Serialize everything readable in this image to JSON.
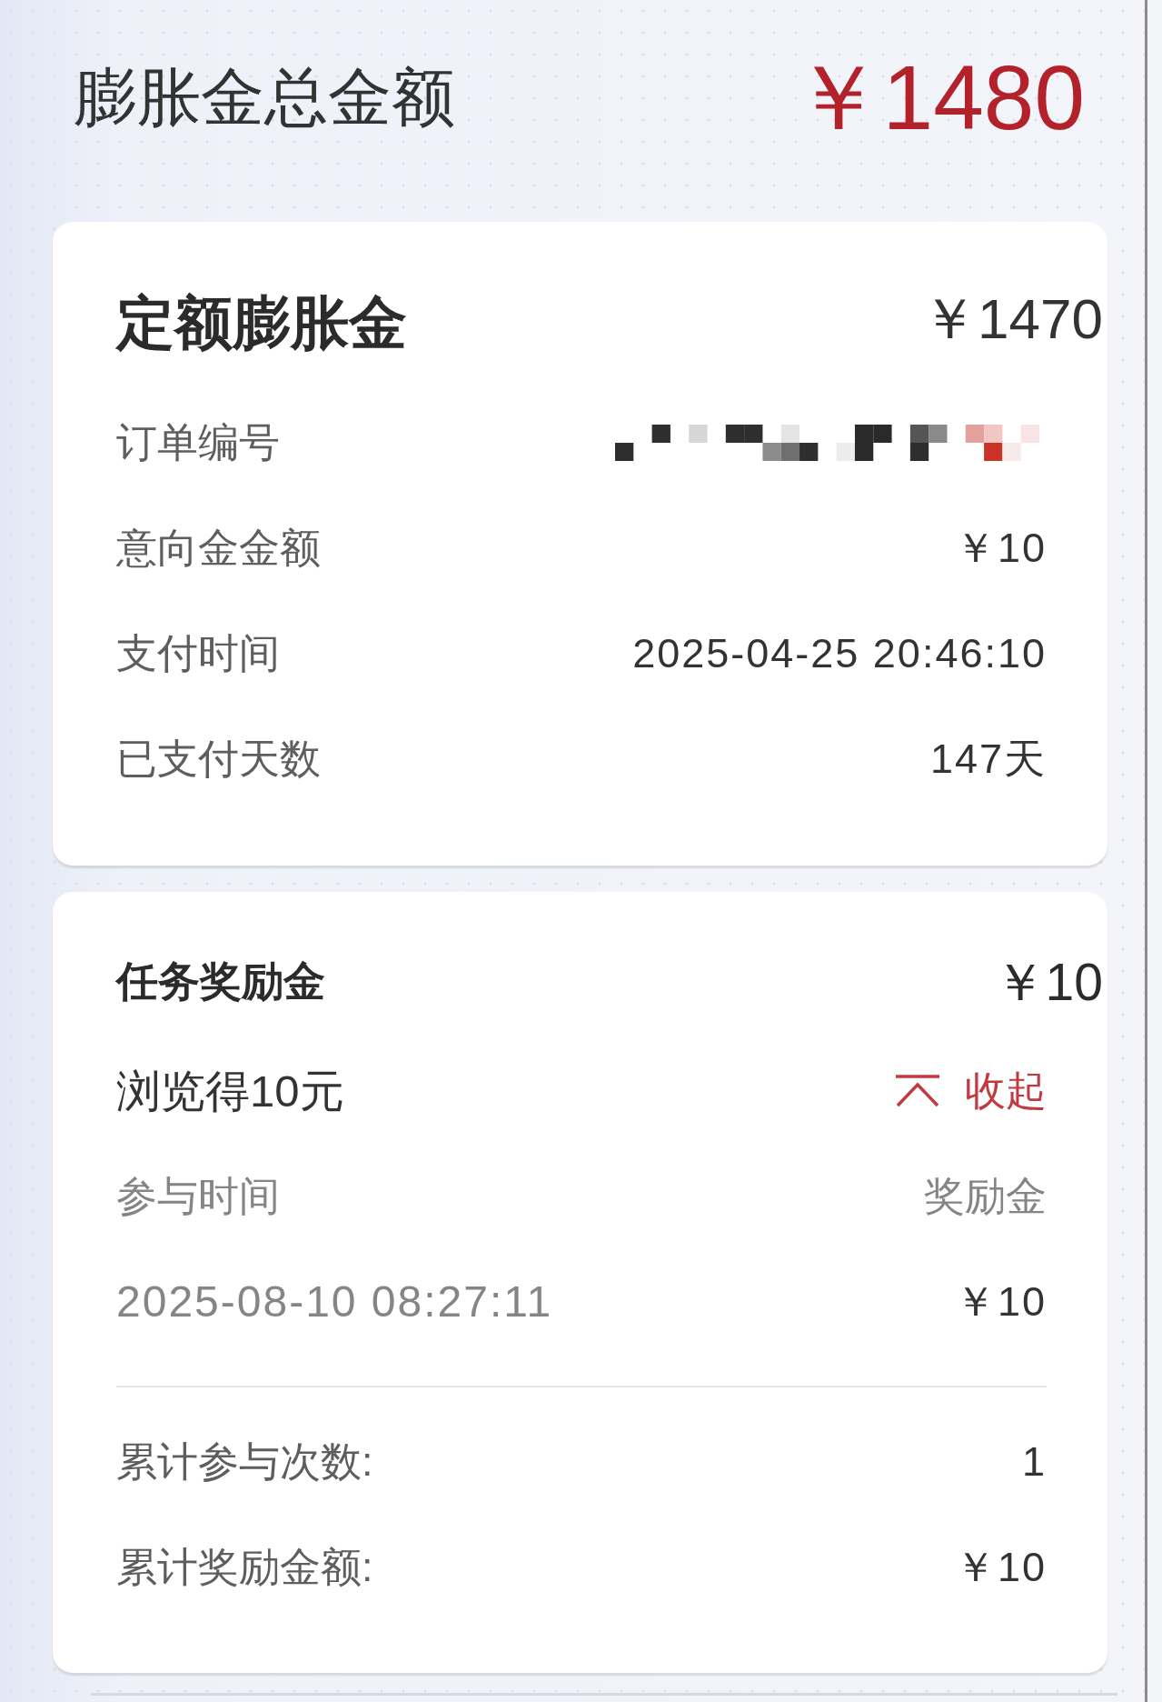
{
  "header": {
    "title": "膨胀金总金额",
    "amount": "￥1480"
  },
  "fixed_bonus": {
    "title": "定额膨胀金",
    "amount": "￥1470",
    "rows": [
      {
        "kind": "redacted",
        "label": "订单编号"
      },
      {
        "kind": "text",
        "label": "意向金金额",
        "value": "￥10"
      },
      {
        "kind": "text",
        "label": "支付时间",
        "value": "2025-04-25 20:46:10"
      },
      {
        "kind": "text",
        "label": "已支付天数",
        "value": "147天"
      }
    ]
  },
  "task_bonus": {
    "title": "任务奖励金",
    "amount": "￥10",
    "task": {
      "name": "浏览得10元",
      "toggle": "收起",
      "expanded": true
    },
    "columns": [
      "参与时间",
      "奖励金"
    ],
    "records": [
      {
        "time": "2025-08-10 08:27:11",
        "reward": "￥10"
      }
    ],
    "summary": [
      {
        "label": "累计参与次数:",
        "value": "1"
      },
      {
        "label": "累计奖励金额:",
        "value": "￥10"
      }
    ]
  }
}
